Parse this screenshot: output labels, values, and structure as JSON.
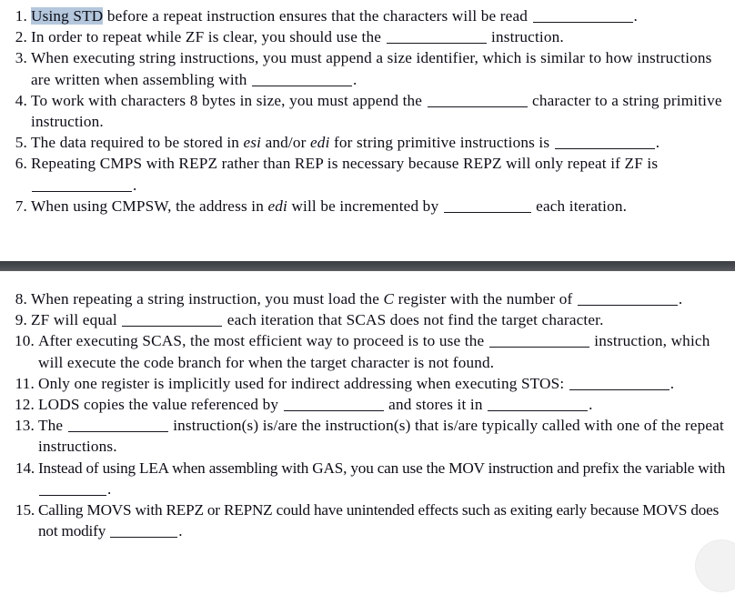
{
  "document": {
    "title": "x86 String Instructions Fill-in-the-Blank Worksheet",
    "divider_color": "#42464a",
    "highlight_color": "#b4c7dc",
    "text_color": "#0c0c16",
    "blank_placeholder": "____________"
  },
  "sections": [
    {
      "id": "section-top",
      "items": [
        {
          "number": "1.",
          "parts": [
            {
              "type": "highlight",
              "text": "Using STD"
            },
            {
              "type": "text",
              "text": " before a repeat instruction ensures that the characters will be read "
            },
            {
              "type": "blank",
              "size": "w-lg"
            },
            {
              "type": "text",
              "text": "."
            }
          ]
        },
        {
          "number": "2.",
          "parts": [
            {
              "type": "text",
              "text": "In order to repeat while ZF is clear, you should use the "
            },
            {
              "type": "blank",
              "size": "w-lg"
            },
            {
              "type": "text",
              "text": " instruction."
            }
          ]
        },
        {
          "number": "3.",
          "parts": [
            {
              "type": "text",
              "text": "When executing string instructions, you must append a size identifier, which is similar to how instructions are written when assembling with "
            },
            {
              "type": "blank",
              "size": "w-lg"
            },
            {
              "type": "text",
              "text": "."
            }
          ]
        },
        {
          "number": "4.",
          "parts": [
            {
              "type": "text",
              "text": "To work with characters 8 bytes in size, you must append the "
            },
            {
              "type": "blank",
              "size": "w-lg"
            },
            {
              "type": "text",
              "text": " character to a string primitive instruction."
            }
          ]
        },
        {
          "number": "5.",
          "parts": [
            {
              "type": "text",
              "text": "The data required to be stored in "
            },
            {
              "type": "italic",
              "text": "esi"
            },
            {
              "type": "text",
              "text": " and/or "
            },
            {
              "type": "italic",
              "text": "edi"
            },
            {
              "type": "text",
              "text": " for string primitive instructions is "
            },
            {
              "type": "blank",
              "size": "w-lg"
            },
            {
              "type": "text",
              "text": "."
            }
          ]
        },
        {
          "number": "6.",
          "parts": [
            {
              "type": "text",
              "text": "Repeating CMPS with REPZ rather than REP is necessary because REPZ will only repeat if ZF is "
            },
            {
              "type": "blank",
              "size": "w-lg"
            },
            {
              "type": "text",
              "text": "."
            }
          ]
        },
        {
          "number": "7.",
          "parts": [
            {
              "type": "text",
              "text": "When using CMPSW, the address in "
            },
            {
              "type": "italic",
              "text": "edi"
            },
            {
              "type": "text",
              "text": " will be incremented by "
            },
            {
              "type": "blank",
              "size": "w-md"
            },
            {
              "type": "text",
              "text": " each iteration."
            }
          ]
        }
      ]
    },
    {
      "id": "section-bottom",
      "items": [
        {
          "number": "8.",
          "parts": [
            {
              "type": "text",
              "text": "When repeating a string instruction, you must load the "
            },
            {
              "type": "italic",
              "text": "C"
            },
            {
              "type": "text",
              "text": " register with the number of "
            },
            {
              "type": "blank",
              "size": "w-lg"
            },
            {
              "type": "text",
              "text": "."
            }
          ]
        },
        {
          "number": "9.",
          "parts": [
            {
              "type": "text",
              "text": "ZF will equal "
            },
            {
              "type": "blank",
              "size": "w-lg"
            },
            {
              "type": "text",
              "text": " each iteration that SCAS does not find the target character."
            }
          ]
        },
        {
          "number": "10.",
          "indent": true,
          "parts": [
            {
              "type": "text",
              "text": "After executing SCAS, the most efficient way to proceed is to use the "
            },
            {
              "type": "blank",
              "size": "w-lg"
            },
            {
              "type": "text",
              "text": " instruction, which will execute the code branch for when the target character is not found."
            }
          ]
        },
        {
          "number": "11.",
          "indent": true,
          "parts": [
            {
              "type": "text",
              "text": "Only one register is implicitly used for indirect addressing when executing STOS: "
            },
            {
              "type": "blank",
              "size": "w-lg"
            },
            {
              "type": "text",
              "text": "."
            }
          ]
        },
        {
          "number": "12.",
          "indent": true,
          "parts": [
            {
              "type": "text",
              "text": "LODS copies the value referenced by "
            },
            {
              "type": "blank",
              "size": "w-lg"
            },
            {
              "type": "text",
              "text": " and stores it in "
            },
            {
              "type": "blank",
              "size": "w-lg"
            },
            {
              "type": "text",
              "text": "."
            }
          ]
        },
        {
          "number": "13.",
          "indent": true,
          "parts": [
            {
              "type": "text",
              "text": "The "
            },
            {
              "type": "blank",
              "size": "w-lg"
            },
            {
              "type": "text",
              "text": " instruction(s) is/are the instruction(s) that is/are typically called with one of the repeat instructions."
            }
          ]
        },
        {
          "number": "14.",
          "indent": true,
          "condensed": true,
          "parts": [
            {
              "type": "text",
              "text": "Instead of using LEA when assembling with GAS, you can use the MOV instruction and prefix the variable with "
            },
            {
              "type": "blank",
              "size": "w-sm"
            },
            {
              "type": "text",
              "text": "."
            }
          ]
        },
        {
          "number": "15.",
          "indent": true,
          "condensed": true,
          "parts": [
            {
              "type": "text",
              "text": "Calling MOVS with REPZ or REPNZ could have unintended effects such as exiting early because MOVS does not modify "
            },
            {
              "type": "blank",
              "size": "w-sm"
            },
            {
              "type": "text",
              "text": "."
            }
          ]
        }
      ]
    }
  ],
  "overlay": {
    "floating_circle": "scroll-indicator-circle"
  }
}
